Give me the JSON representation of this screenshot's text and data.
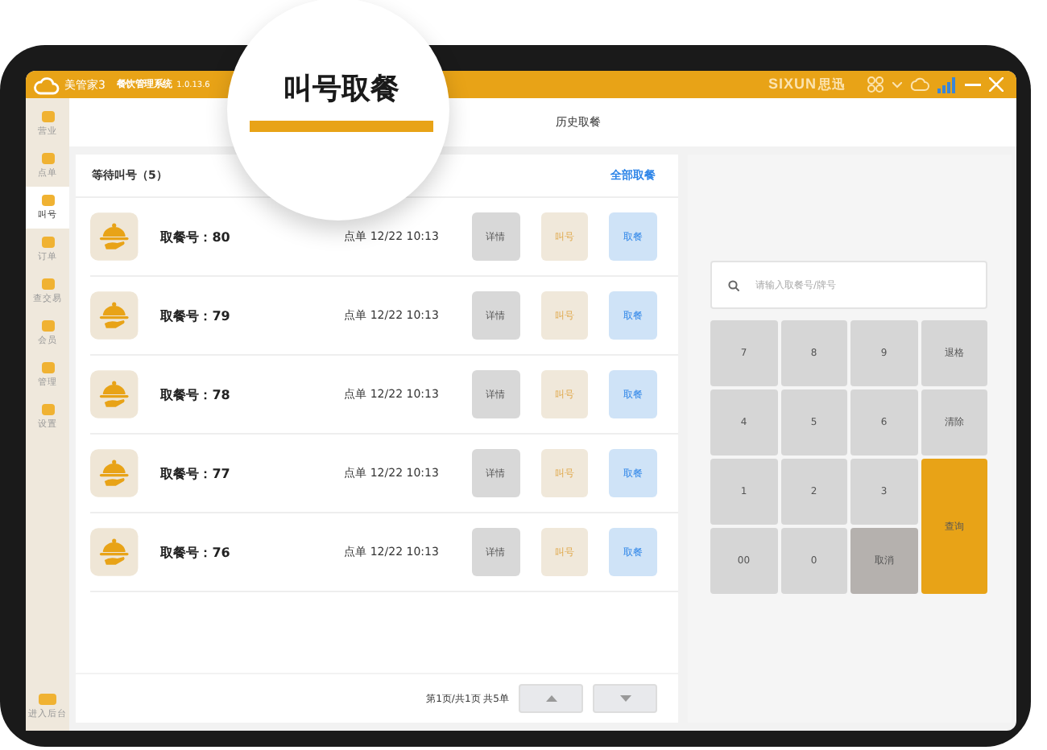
{
  "title_bar": {
    "logo": "美管家3",
    "app_name": "餐饮管理系统",
    "version": "1.0.13.6",
    "brand": "SIXUN",
    "brand_cn": "思迅"
  },
  "sidebar": {
    "items": [
      {
        "label": "营业",
        "selected": false
      },
      {
        "label": "点单",
        "selected": false
      },
      {
        "label": "叫号",
        "selected": true
      },
      {
        "label": "订单",
        "selected": false
      },
      {
        "label": "查交易",
        "selected": false
      },
      {
        "label": "会员",
        "selected": false
      },
      {
        "label": "管理",
        "selected": false
      },
      {
        "label": "设置",
        "selected": false
      }
    ],
    "footer": "进入后台"
  },
  "tabs": [
    {
      "label": "叫号取餐",
      "selected": true
    },
    {
      "label": "历史取餐",
      "selected": false
    }
  ],
  "queue": {
    "title": "等待叫号（5）",
    "action": "全部取餐",
    "rows": [
      {
        "number_label": "取餐号：80",
        "time": "点单 12/22 10:13",
        "buttons": [
          "详情",
          "叫号",
          "取餐"
        ]
      },
      {
        "number_label": "取餐号：79",
        "time": "点单 12/22 10:13",
        "buttons": [
          "详情",
          "叫号",
          "取餐"
        ]
      },
      {
        "number_label": "取餐号：78",
        "time": "点单 12/22 10:13",
        "buttons": [
          "详情",
          "叫号",
          "取餐"
        ]
      },
      {
        "number_label": "取餐号：77",
        "time": "点单 12/22 10:13",
        "buttons": [
          "详情",
          "叫号",
          "取餐"
        ]
      },
      {
        "number_label": "取餐号：76",
        "time": "点单 12/22 10:13",
        "buttons": [
          "详情",
          "叫号",
          "取餐"
        ]
      }
    ],
    "pagination": "第1页/共1页 共5单"
  },
  "keypad": {
    "placeholder": "请输入取餐号/牌号",
    "keys": [
      {
        "label": "7",
        "kind": "digit"
      },
      {
        "label": "8",
        "kind": "digit"
      },
      {
        "label": "9",
        "kind": "digit"
      },
      {
        "label": "退格",
        "kind": "action"
      },
      {
        "label": "4",
        "kind": "digit"
      },
      {
        "label": "5",
        "kind": "digit"
      },
      {
        "label": "6",
        "kind": "digit"
      },
      {
        "label": "清除",
        "kind": "action"
      },
      {
        "label": "1",
        "kind": "digit"
      },
      {
        "label": "2",
        "kind": "digit"
      },
      {
        "label": "3",
        "kind": "digit"
      },
      {
        "label": "查询",
        "kind": "submit"
      },
      {
        "label": "00",
        "kind": "digit"
      },
      {
        "label": "0",
        "kind": "digit"
      },
      {
        "label": "取消",
        "kind": "cancel"
      }
    ]
  }
}
